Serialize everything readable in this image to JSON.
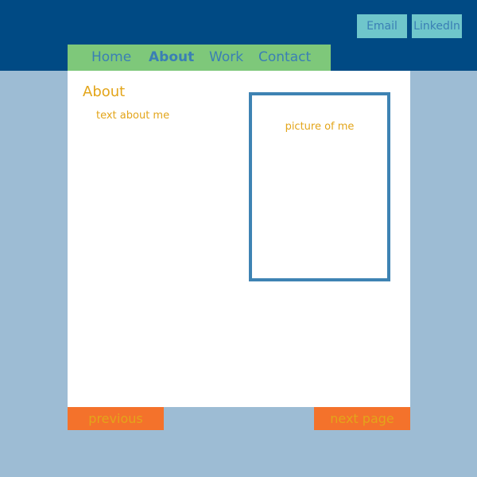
{
  "header": {
    "social": {
      "email_label": "Email",
      "linkedin_label": "LinkedIn"
    },
    "nav": {
      "items": [
        {
          "label": "Home"
        },
        {
          "label": "About",
          "active": true
        },
        {
          "label": "Work"
        },
        {
          "label": "Contact"
        }
      ]
    }
  },
  "main": {
    "title": "About",
    "text": "text about me",
    "picture_label": "picture of me"
  },
  "pager": {
    "previous_label": "previous",
    "next_label": "next page"
  },
  "colors": {
    "header_bg": "#004a84",
    "nav_bg": "#7ec87a",
    "page_bg": "#9dbcd4",
    "social_btn_bg": "#6fc6cb",
    "link_color": "#3a7fb5",
    "text_accent": "#e3a51a",
    "pager_bg": "#f4722b",
    "frame_border": "#3e83b3"
  }
}
